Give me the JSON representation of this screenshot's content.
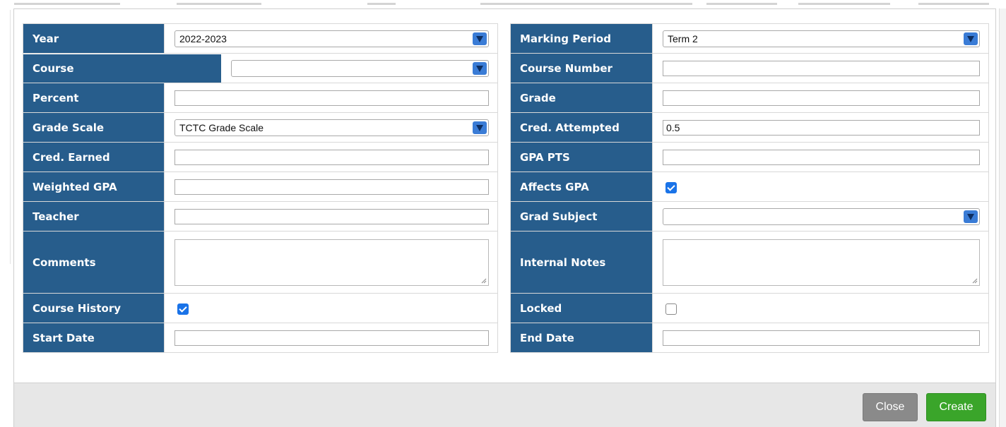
{
  "colors": {
    "label_bg": "#275d8c",
    "select_arrow": "#3a7cd6",
    "checkbox_checked": "#1a73e8",
    "close_button": "#8a8a8a",
    "create_button": "#3aa52a",
    "footer_bg": "#e7e7e7"
  },
  "form": {
    "left": {
      "year": {
        "label": "Year",
        "value": "2022-2023"
      },
      "course": {
        "label": "Course",
        "value": ""
      },
      "percent": {
        "label": "Percent",
        "value": ""
      },
      "grade_scale": {
        "label": "Grade Scale",
        "value": "TCTC Grade Scale"
      },
      "cred_earned": {
        "label": "Cred. Earned",
        "value": ""
      },
      "weighted_gpa": {
        "label": "Weighted GPA",
        "value": ""
      },
      "teacher": {
        "label": "Teacher",
        "value": ""
      },
      "comments": {
        "label": "Comments",
        "value": ""
      },
      "course_history": {
        "label": "Course History",
        "checked": true
      },
      "start_date": {
        "label": "Start Date",
        "value": ""
      }
    },
    "right": {
      "marking_period": {
        "label": "Marking Period",
        "value": "Term 2"
      },
      "course_number": {
        "label": "Course Number",
        "value": ""
      },
      "grade": {
        "label": "Grade",
        "value": ""
      },
      "cred_attempted": {
        "label": "Cred. Attempted",
        "value": "0.5"
      },
      "gpa_pts": {
        "label": "GPA PTS",
        "value": ""
      },
      "affects_gpa": {
        "label": "Affects GPA",
        "checked": true
      },
      "grad_subject": {
        "label": "Grad Subject",
        "value": ""
      },
      "internal_notes": {
        "label": "Internal Notes",
        "value": ""
      },
      "locked": {
        "label": "Locked",
        "checked": false
      },
      "end_date": {
        "label": "End Date",
        "value": ""
      }
    }
  },
  "footer": {
    "close_label": "Close",
    "create_label": "Create"
  }
}
